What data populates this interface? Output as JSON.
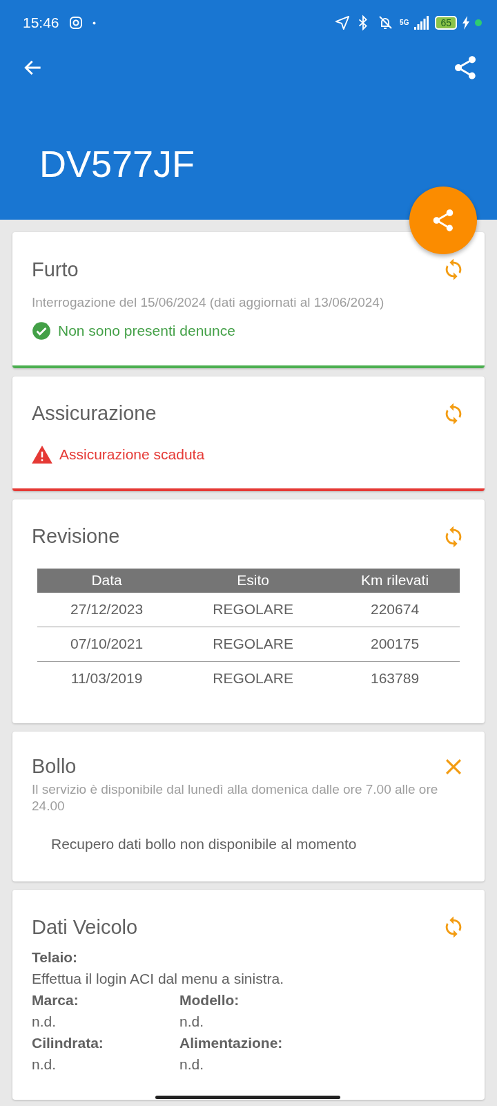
{
  "status_bar": {
    "time": "15:46",
    "network": "5G",
    "battery": "65"
  },
  "app_bar": {
    "title": "DV577JF"
  },
  "cards": [
    {
      "kind": "status",
      "title": "Furto",
      "closable": false,
      "subtitle": "Interrogazione del 15/06/2024 (dati aggiornati al 13/06/2024)",
      "alert": false,
      "message": "Non sono presenti denunce"
    },
    {
      "kind": "status",
      "title": "Assicurazione",
      "closable": false,
      "alert": true,
      "message": "Assicurazione scaduta"
    },
    {
      "kind": "table",
      "title": "Revisione",
      "closable": false,
      "columns": [
        "Data",
        "Esito",
        "Km rilevati"
      ],
      "rows": [
        [
          "27/12/2023",
          "REGOLARE",
          "220674"
        ],
        [
          "07/10/2021",
          "REGOLARE",
          "200175"
        ],
        [
          "11/03/2019",
          "REGOLARE",
          "163789"
        ]
      ]
    },
    {
      "kind": "notice",
      "title": "Bollo",
      "closable": true,
      "subtitle": "Il servizio è disponibile dal lunedì alla domenica dalle ore 7.00 alle ore 24.00",
      "message": "Recupero dati bollo non disponibile al momento"
    },
    {
      "kind": "fields",
      "title": "Dati Veicolo",
      "closable": false,
      "field_rows": [
        [
          {
            "label": "Telaio:",
            "value": "Effettua il login ACI dal menu a sinistra."
          }
        ],
        [
          {
            "label": "Marca:",
            "value": "n.d."
          },
          {
            "label": "Modello:",
            "value": "n.d."
          }
        ],
        [
          {
            "label": "Cilindrata:",
            "value": "n.d."
          },
          {
            "label": "Alimentazione:",
            "value": "n.d."
          }
        ]
      ]
    }
  ]
}
